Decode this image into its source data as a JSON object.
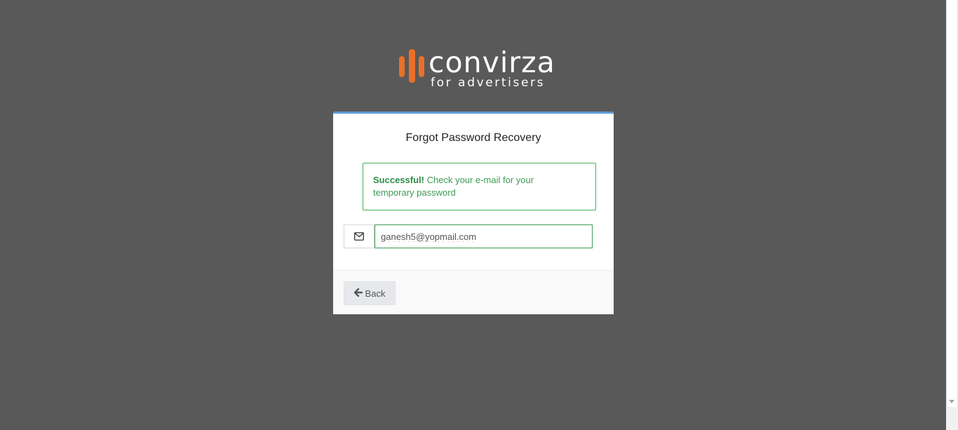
{
  "logo": {
    "word": "convirza",
    "tagline": "for advertisers",
    "brand_color": "#e8702a"
  },
  "card": {
    "title": "Forgot Password Recovery",
    "accent_color": "#5b9bd5"
  },
  "alert": {
    "strong": "Successful!",
    "message": "Check your e-mail for your temporary password",
    "color": "#3e9a55"
  },
  "email_field": {
    "icon": "envelope-icon",
    "value": "ganesh5@yopmail.com"
  },
  "footer": {
    "back_icon": "arrow-left-icon",
    "back_label": "Back"
  }
}
